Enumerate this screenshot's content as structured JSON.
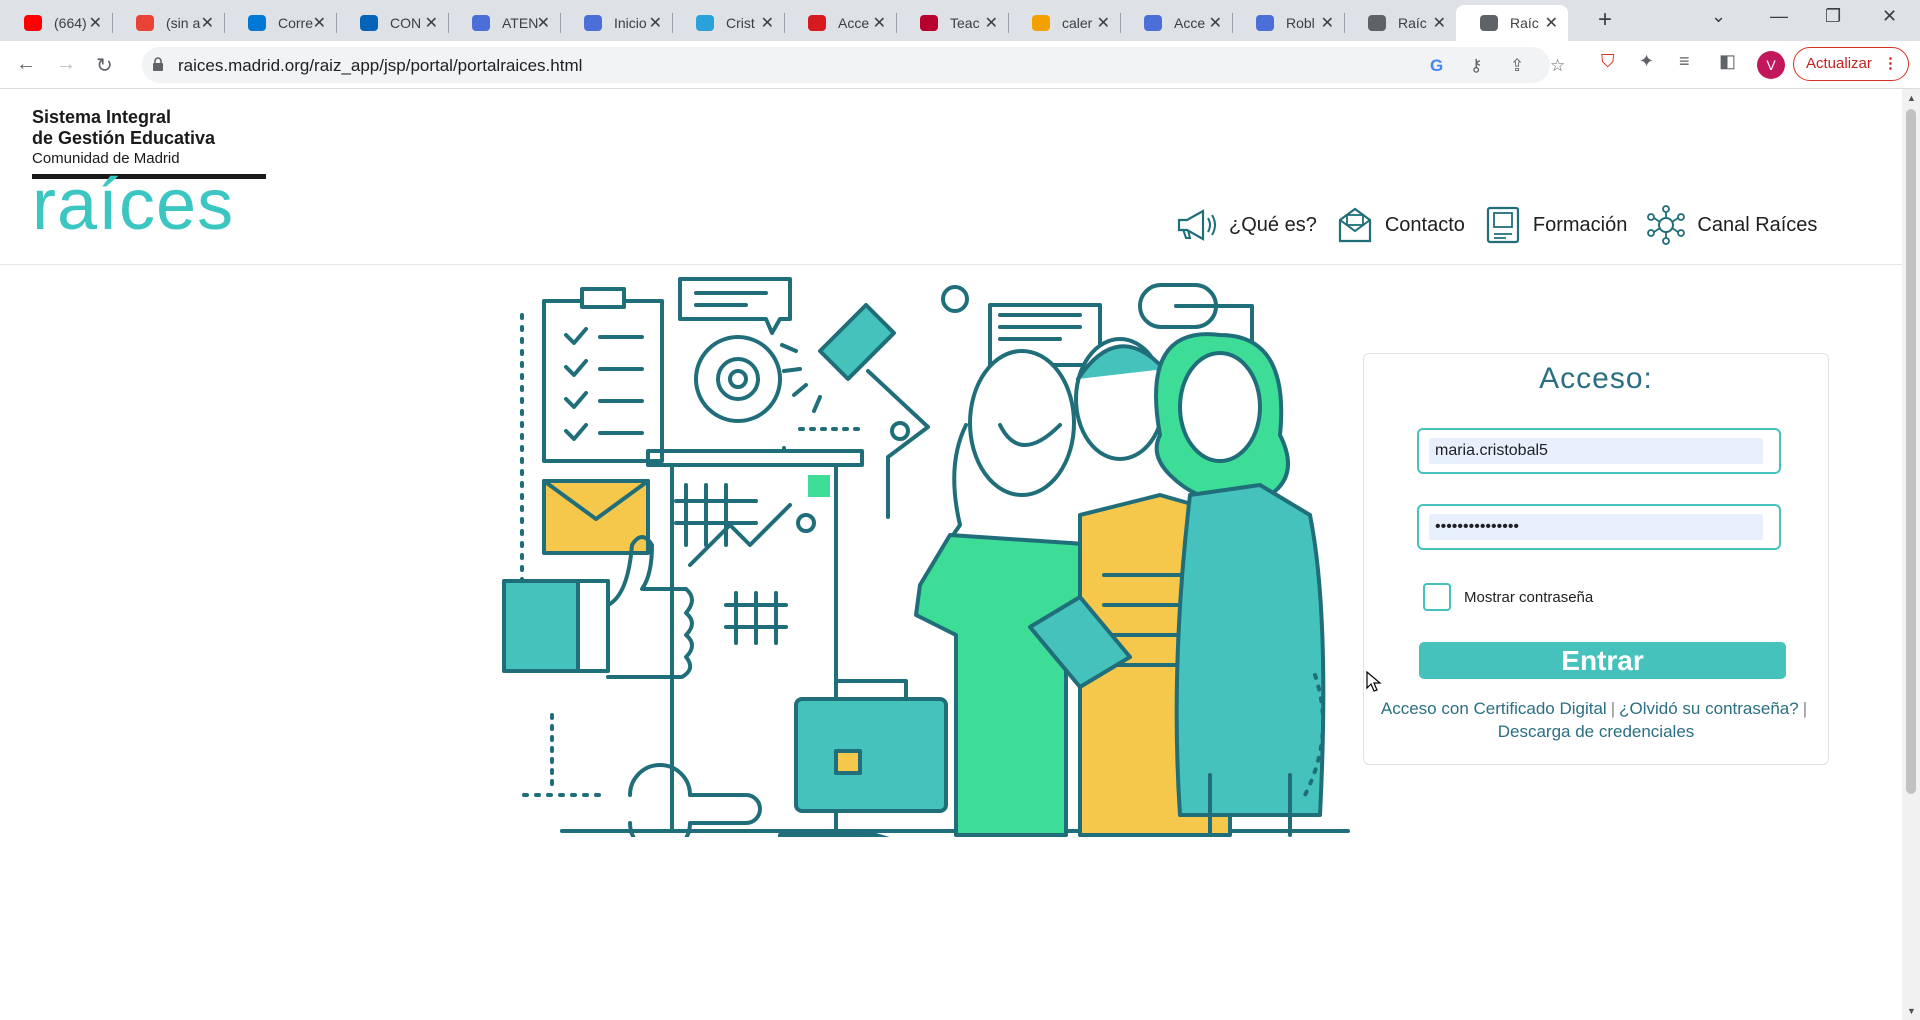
{
  "browser": {
    "tabs": [
      {
        "title": "(664)",
        "icon": "youtube-icon",
        "color": "#ff0000"
      },
      {
        "title": "(sin a",
        "icon": "gmail-icon",
        "color": "#ea4335"
      },
      {
        "title": "Corre",
        "icon": "mail-icon",
        "color": "#0078d4"
      },
      {
        "title": "CON",
        "icon": "cloud-icon",
        "color": "#0364b8"
      },
      {
        "title": "ATEN",
        "icon": "globe-icon",
        "color": "#4c6ed9"
      },
      {
        "title": "Inicio",
        "icon": "globe-icon",
        "color": "#4c6ed9"
      },
      {
        "title": "Crist",
        "icon": "telegram-icon",
        "color": "#2aa1da"
      },
      {
        "title": "Acce",
        "icon": "e-icon",
        "color": "#d71920"
      },
      {
        "title": "Teac",
        "icon": "m-icon",
        "color": "#b7002d"
      },
      {
        "title": "caler",
        "icon": "colorwheel-icon",
        "color": "#f4a100"
      },
      {
        "title": "Acce",
        "icon": "globe-icon",
        "color": "#4c6ed9"
      },
      {
        "title": "Robl",
        "icon": "globe-icon",
        "color": "#4c6ed9"
      },
      {
        "title": "Raíc",
        "icon": "globe-icon",
        "color": "#5f6368"
      },
      {
        "title": "Raíc",
        "icon": "globe-icon",
        "color": "#5f6368"
      }
    ],
    "url": "raices.madrid.org/raiz_app/jsp/portal/portalraices.html",
    "profile_initial": "V",
    "update_label": "Actualizar"
  },
  "logo": {
    "line1": "Sistema Integral",
    "line2": "de Gestión Educativa",
    "line3": "Comunidad de Madrid",
    "wordmark": "raíces"
  },
  "nav": [
    {
      "label": "¿Qué es?",
      "icon": "megaphone-icon"
    },
    {
      "label": "Contacto",
      "icon": "envelope-icon"
    },
    {
      "label": "Formación",
      "icon": "book-icon"
    },
    {
      "label": "Canal Raíces",
      "icon": "network-icon"
    }
  ],
  "login": {
    "title": "Acceso:",
    "username": "maria.cristobal5",
    "password_mask": "•••••••••••••••",
    "show_password_label": "Mostrar contraseña",
    "submit_label": "Entrar",
    "link_certificate": "Acceso con Certificado Digital",
    "link_forgot": "¿Olvidó su contraseña?",
    "link_download": "Descarga de credenciales",
    "separator": "|"
  },
  "colors": {
    "accent": "#45c2bc",
    "brand_text": "#2a6f82",
    "illustration_teal": "#1f6e7a",
    "illustration_green": "#3ddc97",
    "illustration_yellow": "#f5c84c"
  }
}
